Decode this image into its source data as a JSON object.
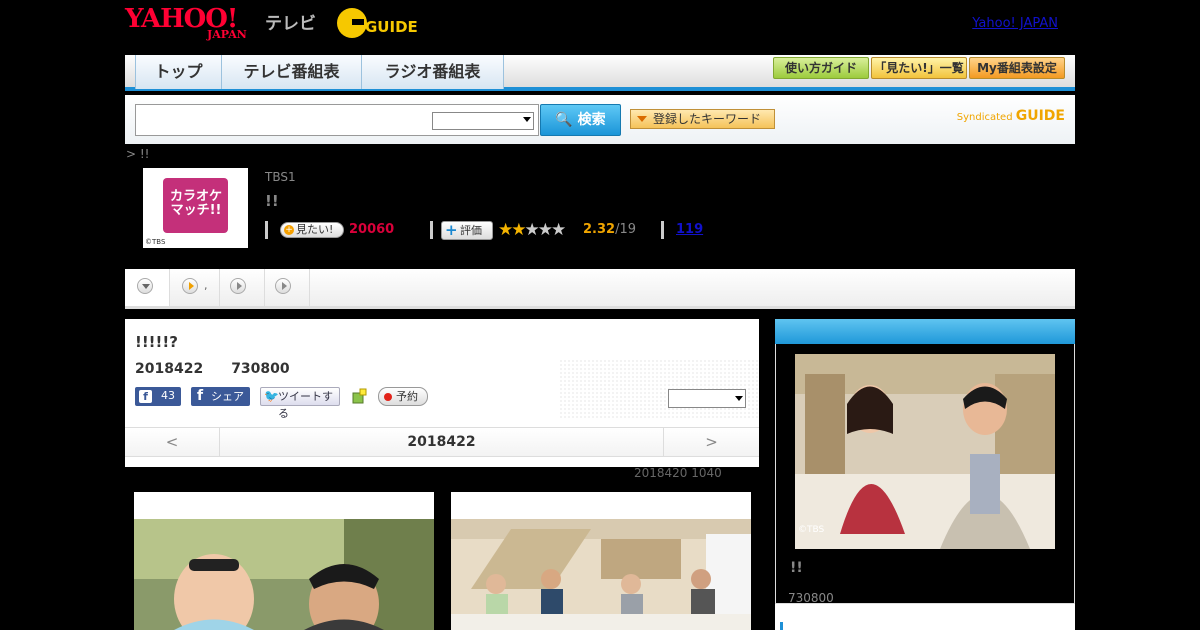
{
  "header": {
    "yahoo_logo": "YAHOO!",
    "yahoo_logo_sub": "JAPAN",
    "tv_logo": "テレビ",
    "gguide_logo": "GUIDE",
    "yahoo_japan_link": "Yahoo! JAPAN"
  },
  "nav": {
    "tabs": [
      "トップ",
      "テレビ番組表",
      "ラジオ番組表"
    ],
    "guide_button": "使い方ガイド",
    "mitai_list_button": "「見たい!」一覧",
    "my_schedule_button": "My番組表設定"
  },
  "search": {
    "button_label": "検索",
    "keyword_button": "登録したキーワード",
    "syndicated_label": "Syndicated",
    "syndicated_logo": "GUIDE"
  },
  "breadcrumb": "> !!",
  "program": {
    "thumb_text": "カラオケマッチ!!",
    "thumb_copyright": "©TBS",
    "channel": "TBS1",
    "title": "!!",
    "mitai_button": "見たい!",
    "mitai_count": "20060",
    "hyoka_button": "評価",
    "rating_value": 2.32,
    "rating": "2.32",
    "rating_denominator": "/19",
    "review_count": "119"
  },
  "tabstrip": {
    "tab2_label": ","
  },
  "episode": {
    "title": "!!!!!?",
    "meta": "2018422　　730800",
    "fb_count": "43",
    "fb_share": "シェア",
    "tweet": "ツイートする",
    "reserve": "予約",
    "date_prev": "<",
    "date_label": "2018422",
    "date_next": ">",
    "updated": "2018420  1040"
  },
  "sidebar": {
    "photo_copyright": "©TBS",
    "title": "!!",
    "meta": "730800"
  },
  "colors": {
    "accent_blue": "#1e90d6",
    "mitai_red": "#d9003a",
    "rating_orange": "#f0a500",
    "yahoo_red": "#ff0033"
  }
}
